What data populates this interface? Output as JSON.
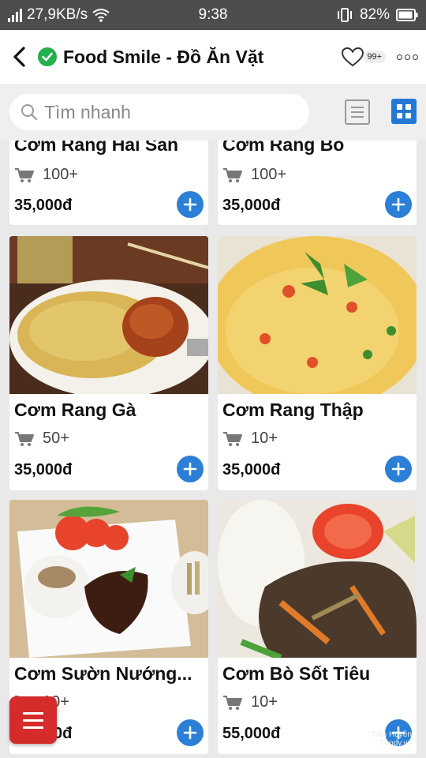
{
  "status_bar": {
    "network_speed": "27,9KB/s",
    "time": "9:38",
    "battery": "82%"
  },
  "header": {
    "title": "Food Smile - Đồ Ăn Vặt",
    "favorites_badge": "99+"
  },
  "search": {
    "placeholder": "Tìm nhanh"
  },
  "products": [
    {
      "name": "Cơm Rang Hải Sản",
      "orders": "100+",
      "price": "35,000đ"
    },
    {
      "name": "Cơm Rang Bò",
      "orders": "100+",
      "price": "35,000đ"
    },
    {
      "name": "Cơm Rang Gà",
      "orders": "50+",
      "price": "35,000đ"
    },
    {
      "name": "Cơm Rang Thập",
      "orders": "10+",
      "price": "35,000đ"
    },
    {
      "name": "Cơm Sườn Nướng...",
      "orders": "10+",
      "price": "35,000đ"
    },
    {
      "name": "Cơm Bò Sốt Tiêu",
      "orders": "10+",
      "price": "55,000đ"
    }
  ],
  "watermark": {
    "line1": "Trần Huyền",
    "line2": "Foody.vn"
  },
  "colors": {
    "accent": "#2b7fd6",
    "verified": "#22b14c",
    "menu_button": "#d62b2b"
  }
}
